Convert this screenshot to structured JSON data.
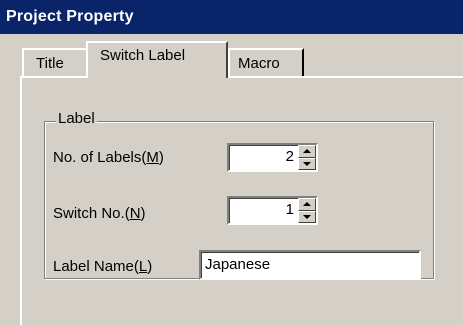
{
  "window": {
    "title": "Project Property"
  },
  "tabs": [
    {
      "label": "Title"
    },
    {
      "label": "Switch Label"
    },
    {
      "label": "Macro"
    }
  ],
  "group": {
    "legend": "Label",
    "labels_count": {
      "label_prefix": "No. of Labels(",
      "mnemonic": "M",
      "label_suffix": ")",
      "value": "2"
    },
    "switch_no": {
      "label_prefix": "Switch No.(",
      "mnemonic": "N",
      "label_suffix": ")",
      "value": "1"
    },
    "label_name": {
      "label_prefix": "Label Name(",
      "mnemonic": "L",
      "label_suffix": ")",
      "value": "Japanese"
    }
  }
}
